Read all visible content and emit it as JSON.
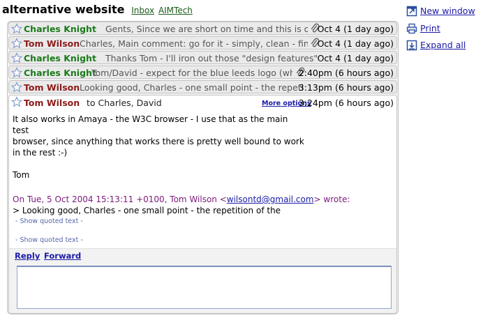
{
  "header": {
    "subject": "alternative website",
    "labels": [
      "Inbox",
      "AIMTech"
    ]
  },
  "collapsed_messages": [
    {
      "sender": "Charles Knight",
      "sender_color": "#1a7a1a",
      "snippet": "Gents, Since we are short on time and this is overdue",
      "has_attachment": true,
      "time": "Oct 4 (1 day ago)"
    },
    {
      "sender": "Tom Wilson",
      "sender_color": "#8c1a1a",
      "snippet": "Charles, Main comment: go for it - simply, clean - fine. S",
      "has_attachment": true,
      "time": "Oct 4 (1 day ago)"
    },
    {
      "sender": "Charles Knight",
      "sender_color": "#1a7a1a",
      "snippet": "Thanks Tom - I'll iron out those \"design features\" - it's du",
      "has_attachment": false,
      "time": "Oct 4 (1 day ago)"
    },
    {
      "sender": "Charles Knight",
      "sender_color": "#1a7a1a",
      "snippet": "Tom/David - expect for the blue leeds logo (which",
      "has_attachment": true,
      "time": "2:40pm (6 hours ago)"
    },
    {
      "sender": "Tom Wilson",
      "sender_color": "#8c1a1a",
      "snippet": "Looking good, Charles - one small point - the repetition",
      "has_attachment": false,
      "time": "3:13pm (6 hours ago)"
    }
  ],
  "open_message": {
    "sender": "Tom Wilson",
    "recipients": "to Charles, David",
    "more_options": "More options",
    "time": "3:24pm (6 hours ago)",
    "body_lines": [
      "It also works in Amaya - the W3C browser - I use that as the main test",
      "browser, since anything that works there is pretty well bound to work",
      "in the rest :-)",
      "",
      "Tom"
    ],
    "attribution_prefix": "On Tue, 5 Oct 2004 15:13:11 +0100, Tom Wilson <",
    "attribution_email": "wilsontd@gmail.com",
    "attribution_suffix": "> wrote:",
    "quote_line": "> Looking good, Charles - one small point - the repetition of the",
    "show_quoted_1": "- Show quoted text -",
    "show_quoted_2": "- Show quoted text -"
  },
  "reply": {
    "reply_label": "Reply",
    "forward_label": "Forward",
    "draft_value": ""
  },
  "sidebar": {
    "new_window": "New window",
    "print": "Print",
    "expand_all": "Expand all"
  }
}
